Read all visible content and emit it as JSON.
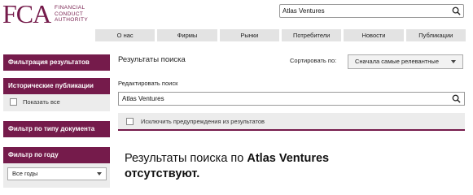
{
  "brand": {
    "mark": "FCA",
    "lines": [
      "FINANCIAL",
      "CONDUCT",
      "AUTHORITY"
    ],
    "color": "#751b4b"
  },
  "header_search": {
    "value": "Atlas Ventures",
    "icon": "search-icon"
  },
  "nav": {
    "items": [
      "О нас",
      "Фирмы",
      "Рынки",
      "Потребители",
      "Новости",
      "Публикации"
    ]
  },
  "sidebar": {
    "filter_results": "Фильтрация результатов",
    "historical": "Исторические публикации",
    "show_all": "Показать все",
    "doc_type": "Фильтр по типу документа",
    "by_year": "Фильтр по году",
    "year_selected": "Все годы"
  },
  "main": {
    "results_title": "Результаты поиска",
    "sort_label": "Сортировать по:",
    "sort_selected": "Сначала самые релевантные",
    "edit_label": "Редактировать поиск",
    "search_value": "Atlas Ventures",
    "exclude_warnings": "Исключить предупреждения из результатов",
    "no_results_prefix": "Результаты поиска по ",
    "no_results_query": "Atlas Ventures",
    "no_results_suffix": "отсутствуют."
  }
}
